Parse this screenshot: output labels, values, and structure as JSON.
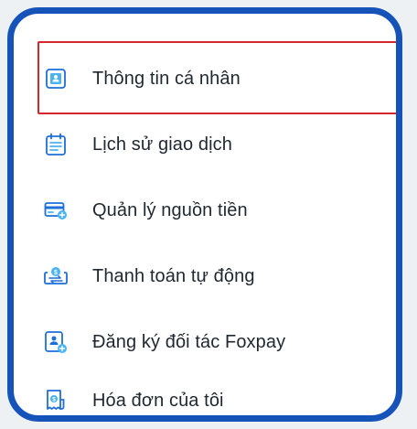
{
  "colors": {
    "frame_border": "#1553b8",
    "highlight_border": "#d7262b",
    "icon_primary": "#1e6fd9",
    "icon_accent": "#4ab3f4",
    "text": "#1f2730"
  },
  "menu": {
    "items": [
      {
        "label": "Thông tin cá nhân",
        "icon": "user-card-icon",
        "highlighted": true
      },
      {
        "label": "Lịch sử giao dịch",
        "icon": "calendar-list-icon",
        "highlighted": false
      },
      {
        "label": "Quản lý nguồn tiền",
        "icon": "credit-card-icon",
        "highlighted": false
      },
      {
        "label": "Thanh toán tự động",
        "icon": "auto-payment-icon",
        "highlighted": false
      },
      {
        "label": "Đăng ký đối tác Foxpay",
        "icon": "partner-register-icon",
        "highlighted": false
      },
      {
        "label": "Hóa đơn của tôi",
        "icon": "receipt-icon",
        "highlighted": false
      }
    ]
  }
}
